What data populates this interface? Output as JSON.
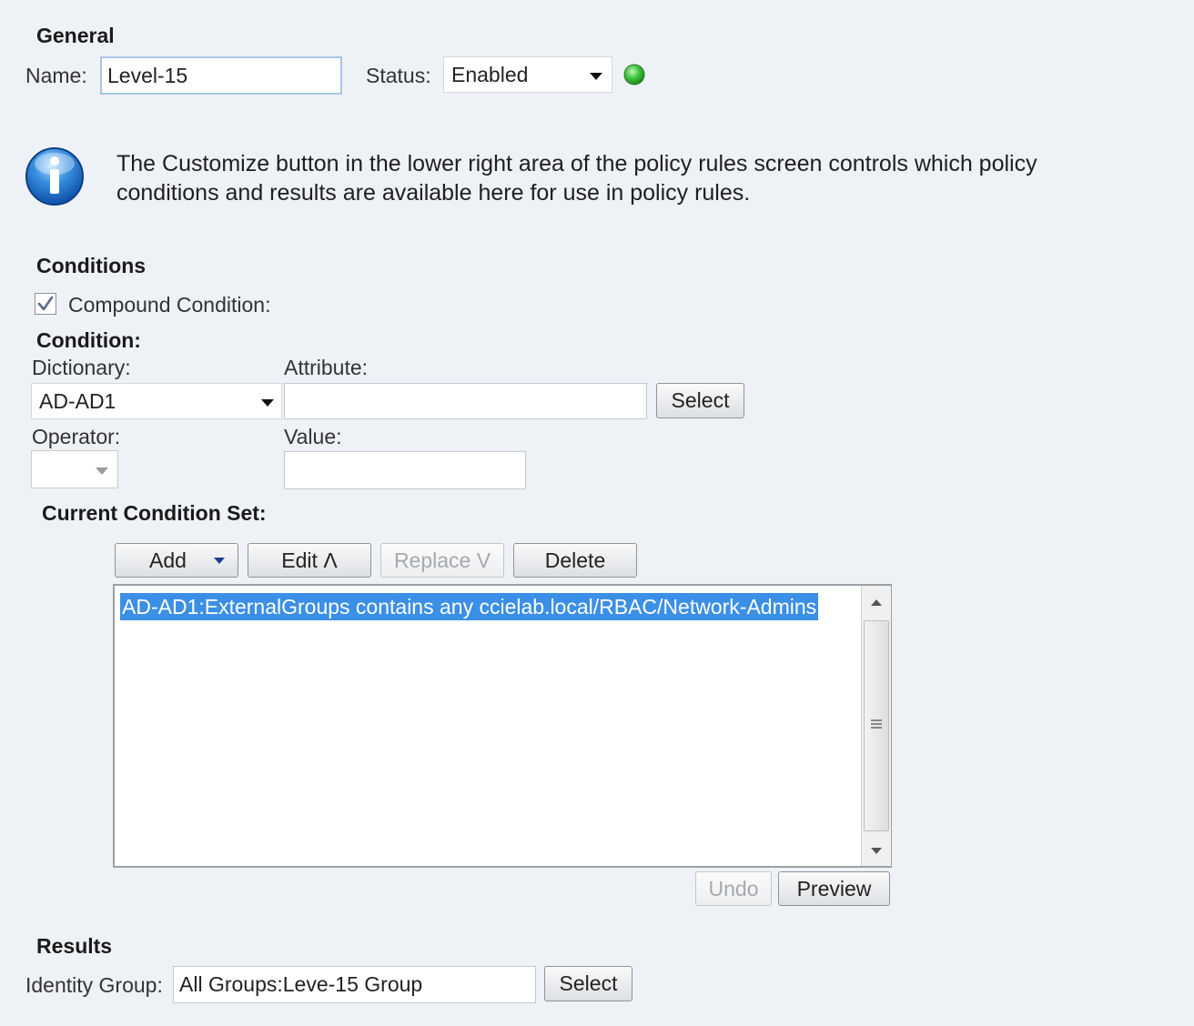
{
  "general": {
    "title": "General",
    "name_label": "Name:",
    "name_value": "Level-15",
    "status_label": "Status:",
    "status_value": "Enabled"
  },
  "info": {
    "line1": "The Customize button in the lower right area of the policy rules screen controls which policy",
    "line2": "conditions and results are available here for use in policy rules."
  },
  "conditions": {
    "title": "Conditions",
    "compound_label": "Compound Condition:",
    "compound_checked": true,
    "condition_label": "Condition:",
    "dictionary_label": "Dictionary:",
    "dictionary_value": "AD-AD1",
    "attribute_label": "Attribute:",
    "attribute_value": "",
    "select_label": "Select",
    "operator_label": "Operator:",
    "operator_value": "",
    "value_label": "Value:",
    "value_value": "",
    "current_set_label": "Current Condition Set:",
    "toolbar": {
      "add": "Add",
      "edit": "Edit Λ",
      "replace": "Replace V",
      "delete": "Delete"
    },
    "items": [
      "AD-AD1:ExternalGroups contains any ccielab.local/RBAC/Network-Admins"
    ],
    "undo": "Undo",
    "preview": "Preview"
  },
  "results": {
    "title": "Results",
    "identity_group_label": "Identity Group:",
    "identity_group_value": "All Groups:Leve-15 Group",
    "select_label": "Select"
  },
  "colors": {
    "status_indicator": "#3cc23c",
    "selection": "#3b8fe6",
    "background": "#eef1f5"
  }
}
